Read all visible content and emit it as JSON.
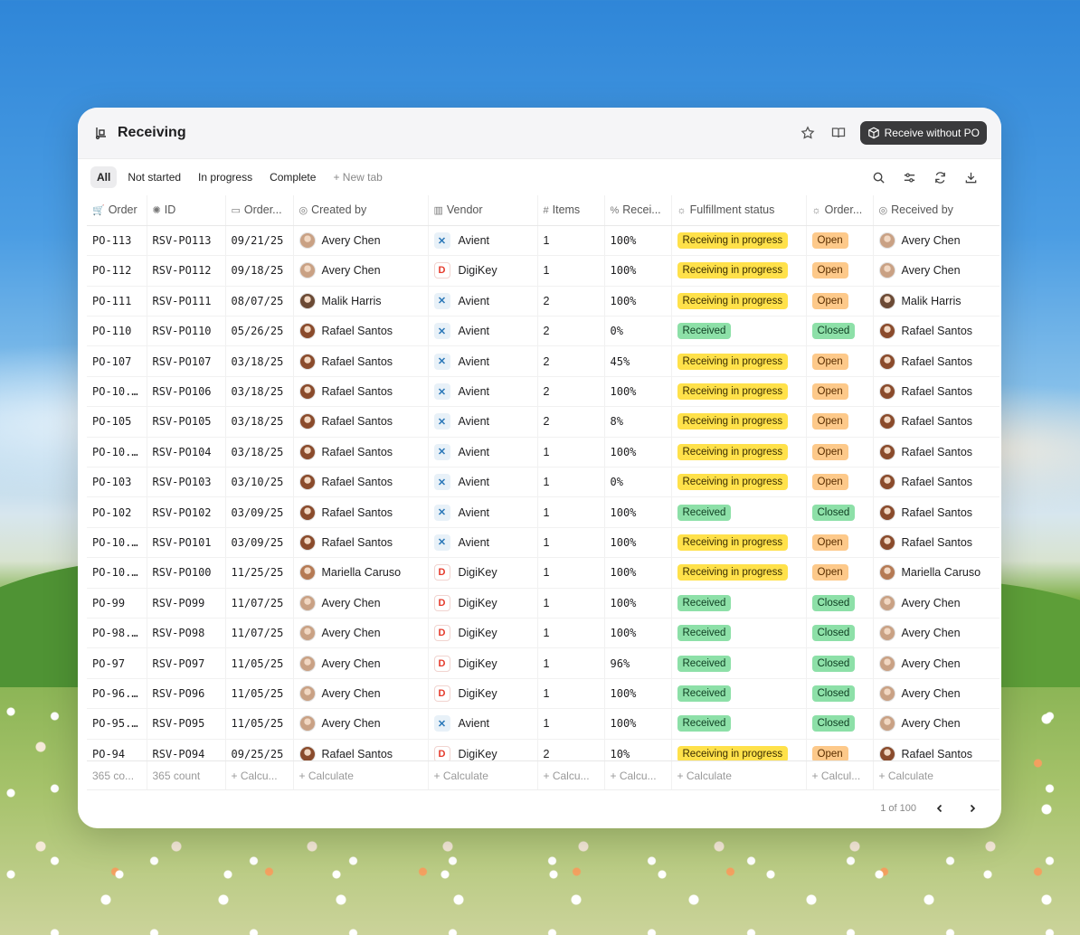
{
  "window": {
    "title": "Receiving",
    "primary_action": "Receive without PO"
  },
  "tabs": [
    "All",
    "Not started",
    "In progress",
    "Complete"
  ],
  "new_tab_label": "New tab",
  "columns": {
    "order": "Order",
    "id": "ID",
    "order_date": "Order...",
    "created_by": "Created by",
    "vendor": "Vendor",
    "items": "Items",
    "received_pct": "Recei...",
    "fulfillment": "Fulfillment status",
    "order_status": "Order...",
    "received_by": "Received by"
  },
  "rows": [
    {
      "order": "PO-113",
      "id": "RSV-PO113",
      "date": "09/21/25",
      "created": "Avery Chen",
      "vendor": "Avient",
      "items": "1",
      "pct": "100%",
      "fulfill": "Receiving in progress",
      "status": "Open",
      "received_by": "Avery Chen"
    },
    {
      "order": "PO-112",
      "id": "RSV-PO112",
      "date": "09/18/25",
      "created": "Avery Chen",
      "vendor": "DigiKey",
      "items": "1",
      "pct": "100%",
      "fulfill": "Receiving in progress",
      "status": "Open",
      "received_by": "Avery Chen"
    },
    {
      "order": "PO-111",
      "id": "RSV-PO111",
      "date": "08/07/25",
      "created": "Malik Harris",
      "vendor": "Avient",
      "items": "2",
      "pct": "100%",
      "fulfill": "Receiving in progress",
      "status": "Open",
      "received_by": "Malik Harris"
    },
    {
      "order": "PO-110",
      "id": "RSV-PO110",
      "date": "05/26/25",
      "created": "Rafael Santos",
      "vendor": "Avient",
      "items": "2",
      "pct": "0%",
      "fulfill": "Received",
      "status": "Closed",
      "received_by": "Rafael Santos"
    },
    {
      "order": "PO-107",
      "id": "RSV-PO107",
      "date": "03/18/25",
      "created": "Rafael Santos",
      "vendor": "Avient",
      "items": "2",
      "pct": "45%",
      "fulfill": "Receiving in progress",
      "status": "Open",
      "received_by": "Rafael Santos"
    },
    {
      "order": "PO-10...",
      "id": "RSV-PO106",
      "date": "03/18/25",
      "created": "Rafael Santos",
      "vendor": "Avient",
      "items": "2",
      "pct": "100%",
      "fulfill": "Receiving in progress",
      "status": "Open",
      "received_by": "Rafael Santos"
    },
    {
      "order": "PO-105",
      "id": "RSV-PO105",
      "date": "03/18/25",
      "created": "Rafael Santos",
      "vendor": "Avient",
      "items": "2",
      "pct": "8%",
      "fulfill": "Receiving in progress",
      "status": "Open",
      "received_by": "Rafael Santos"
    },
    {
      "order": "PO-10...",
      "id": "RSV-PO104",
      "date": "03/18/25",
      "created": "Rafael Santos",
      "vendor": "Avient",
      "items": "1",
      "pct": "100%",
      "fulfill": "Receiving in progress",
      "status": "Open",
      "received_by": "Rafael Santos"
    },
    {
      "order": "PO-103",
      "id": "RSV-PO103",
      "date": "03/10/25",
      "created": "Rafael Santos",
      "vendor": "Avient",
      "items": "1",
      "pct": "0%",
      "fulfill": "Receiving in progress",
      "status": "Open",
      "received_by": "Rafael Santos"
    },
    {
      "order": "PO-102",
      "id": "RSV-PO102",
      "date": "03/09/25",
      "created": "Rafael Santos",
      "vendor": "Avient",
      "items": "1",
      "pct": "100%",
      "fulfill": "Received",
      "status": "Closed",
      "received_by": "Rafael Santos"
    },
    {
      "order": "PO-10...",
      "id": "RSV-PO101",
      "date": "03/09/25",
      "created": "Rafael Santos",
      "vendor": "Avient",
      "items": "1",
      "pct": "100%",
      "fulfill": "Receiving in progress",
      "status": "Open",
      "received_by": "Rafael Santos"
    },
    {
      "order": "PO-10...",
      "id": "RSV-PO100",
      "date": "11/25/25",
      "created": "Mariella Caruso",
      "vendor": "DigiKey",
      "items": "1",
      "pct": "100%",
      "fulfill": "Receiving in progress",
      "status": "Open",
      "received_by": "Mariella Caruso"
    },
    {
      "order": "PO-99",
      "id": "RSV-PO99",
      "date": "11/07/25",
      "created": "Avery Chen",
      "vendor": "DigiKey",
      "items": "1",
      "pct": "100%",
      "fulfill": "Received",
      "status": "Closed",
      "received_by": "Avery Chen"
    },
    {
      "order": "PO-98...",
      "id": "RSV-PO98",
      "date": "11/07/25",
      "created": "Avery Chen",
      "vendor": "DigiKey",
      "items": "1",
      "pct": "100%",
      "fulfill": "Received",
      "status": "Closed",
      "received_by": "Avery Chen"
    },
    {
      "order": "PO-97",
      "id": "RSV-PO97",
      "date": "11/05/25",
      "created": "Avery Chen",
      "vendor": "DigiKey",
      "items": "1",
      "pct": "96%",
      "fulfill": "Received",
      "status": "Closed",
      "received_by": "Avery Chen"
    },
    {
      "order": "PO-96...",
      "id": "RSV-PO96",
      "date": "11/05/25",
      "created": "Avery Chen",
      "vendor": "DigiKey",
      "items": "1",
      "pct": "100%",
      "fulfill": "Received",
      "status": "Closed",
      "received_by": "Avery Chen"
    },
    {
      "order": "PO-95...",
      "id": "RSV-PO95",
      "date": "11/05/25",
      "created": "Avery Chen",
      "vendor": "Avient",
      "items": "1",
      "pct": "100%",
      "fulfill": "Received",
      "status": "Closed",
      "received_by": "Avery Chen"
    },
    {
      "order": "PO-94",
      "id": "RSV-PO94",
      "date": "09/25/25",
      "created": "Rafael Santos",
      "vendor": "DigiKey",
      "items": "2",
      "pct": "10%",
      "fulfill": "Receiving in progress",
      "status": "Open",
      "received_by": "Rafael Santos"
    }
  ],
  "footer": {
    "order": "365 co...",
    "id": "365 count",
    "order_date": "Calcu...",
    "created_by": "Calculate",
    "vendor": "Calculate",
    "items": "Calcu...",
    "received_pct": "Calcu...",
    "fulfillment": "Calculate",
    "order_status": "Calcul...",
    "received_by": "Calculate"
  },
  "pager": {
    "label": "1 of 100"
  },
  "avatar_colors": {
    "Avery Chen": "#c9a184",
    "Malik Harris": "#6b4a35",
    "Rafael Santos": "#8a4b2c",
    "Mariella Caruso": "#b57a54"
  }
}
